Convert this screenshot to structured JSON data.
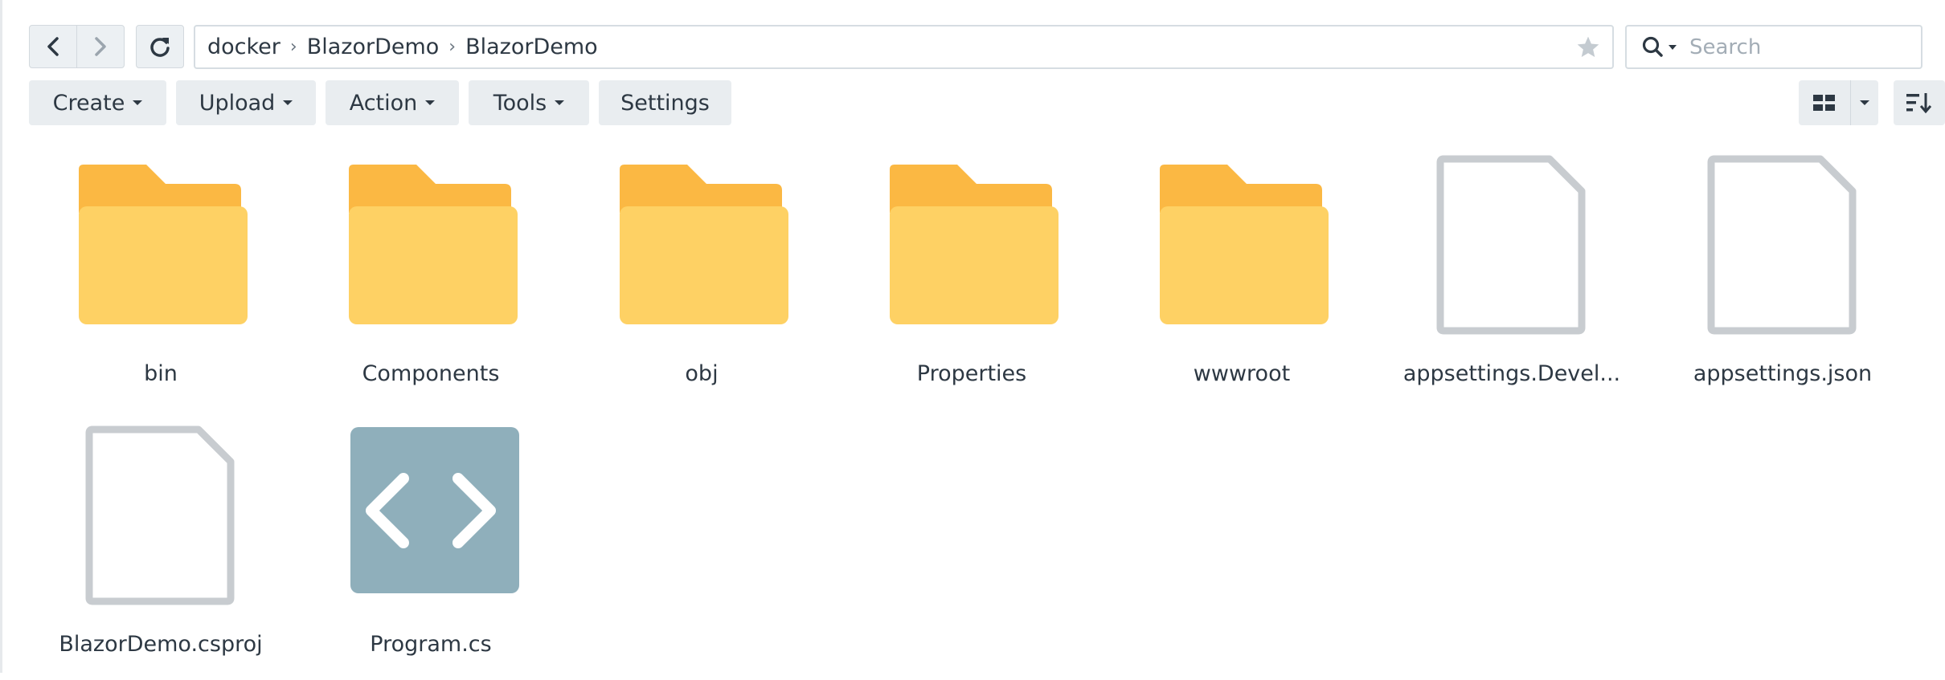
{
  "nav": {
    "back_icon": "chevron-left-icon",
    "forward_icon": "chevron-right-icon",
    "refresh_icon": "refresh-icon"
  },
  "path": {
    "crumbs": [
      "docker",
      "BlazorDemo",
      "BlazorDemo"
    ],
    "separator": "›",
    "favorite_icon": "star-icon"
  },
  "search": {
    "placeholder": "Search",
    "icon": "search-icon"
  },
  "toolbar": {
    "create_label": "Create",
    "upload_label": "Upload",
    "action_label": "Action",
    "tools_label": "Tools",
    "settings_label": "Settings",
    "view_icon": "grid-view-icon",
    "sort_icon": "sort-icon"
  },
  "files": [
    {
      "name": "bin",
      "type": "folder"
    },
    {
      "name": "Components",
      "type": "folder"
    },
    {
      "name": "obj",
      "type": "folder"
    },
    {
      "name": "Properties",
      "type": "folder"
    },
    {
      "name": "wwwroot",
      "type": "folder"
    },
    {
      "name": "appsettings.Devel...",
      "type": "file"
    },
    {
      "name": "appsettings.json",
      "type": "file"
    },
    {
      "name": "BlazorDemo.csproj",
      "type": "file"
    },
    {
      "name": "Program.cs",
      "type": "code"
    }
  ],
  "colors": {
    "folder_back": "#FBB843",
    "folder_front": "#FED164",
    "file_outline": "#C8CCD0",
    "code_bg": "#8FAFBB",
    "button_bg": "#E9EDF0"
  }
}
